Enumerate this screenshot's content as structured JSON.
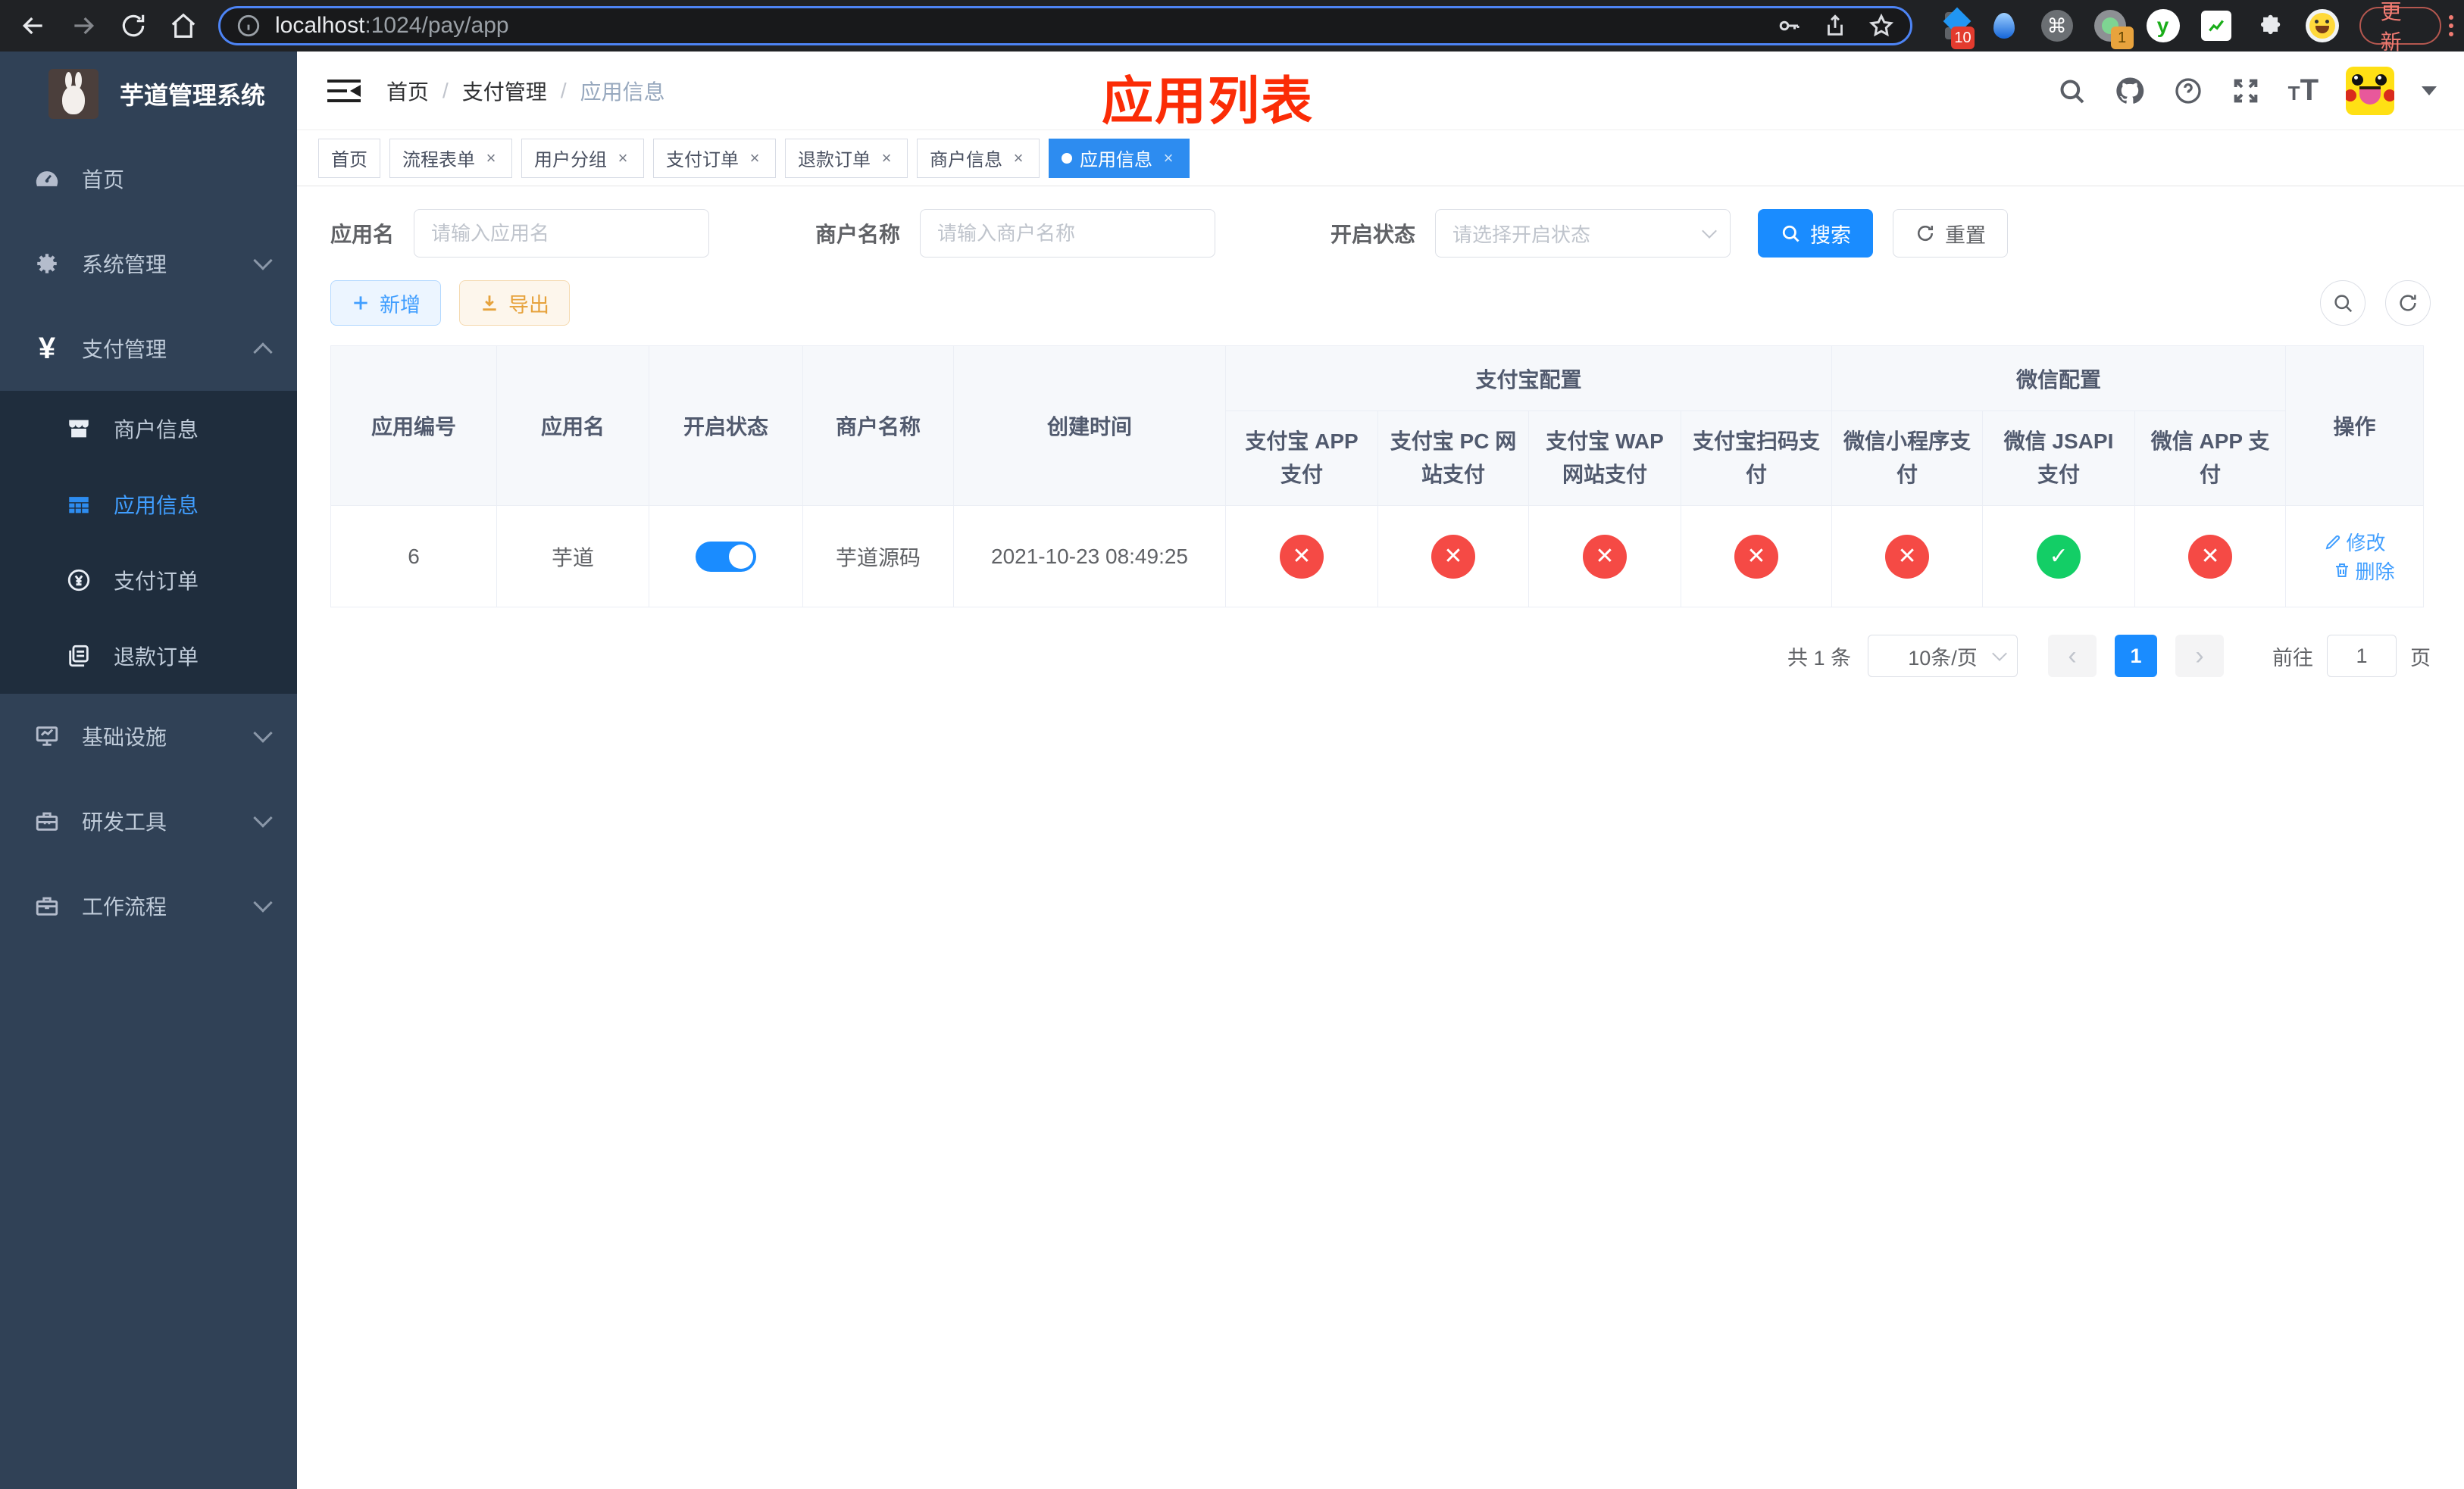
{
  "browser": {
    "url_host": "localhost",
    "url_path": ":1024/pay/app",
    "update_label": "更新",
    "badges": {
      "extension1": "10",
      "extension2": "1"
    }
  },
  "sidebar": {
    "title": "芋道管理系统",
    "items": [
      {
        "label": "首页",
        "icon": "dashboard-icon"
      },
      {
        "label": "系统管理",
        "icon": "gear-icon",
        "expanded": false
      },
      {
        "label": "支付管理",
        "icon": "yen-icon",
        "expanded": true
      },
      {
        "label": "商户信息",
        "icon": "shop-icon",
        "active": false
      },
      {
        "label": "应用信息",
        "icon": "grid-icon",
        "active": true
      },
      {
        "label": "支付订单",
        "icon": "pay-order-icon",
        "active": false
      },
      {
        "label": "退款订单",
        "icon": "refund-icon",
        "active": false
      },
      {
        "label": "基础设施",
        "icon": "monitor-icon",
        "expanded": false
      },
      {
        "label": "研发工具",
        "icon": "toolbox-icon",
        "expanded": false
      },
      {
        "label": "工作流程",
        "icon": "briefcase-icon",
        "expanded": false
      }
    ]
  },
  "navbar": {
    "breadcrumb": [
      "首页",
      "支付管理",
      "应用信息"
    ],
    "annotation": "应用列表",
    "annotation_color": "#fb2c06"
  },
  "tabs": [
    {
      "label": "首页",
      "closable": false,
      "active": false
    },
    {
      "label": "流程表单",
      "closable": true,
      "active": false
    },
    {
      "label": "用户分组",
      "closable": true,
      "active": false
    },
    {
      "label": "支付订单",
      "closable": true,
      "active": false
    },
    {
      "label": "退款订单",
      "closable": true,
      "active": false
    },
    {
      "label": "商户信息",
      "closable": true,
      "active": false
    },
    {
      "label": "应用信息",
      "closable": true,
      "active": true
    }
  ],
  "filters": {
    "app_name_label": "应用名",
    "app_name_placeholder": "请输入应用名",
    "merchant_label": "商户名称",
    "merchant_placeholder": "请输入商户名称",
    "status_label": "开启状态",
    "status_placeholder": "请选择开启状态",
    "search_label": "搜索",
    "reset_label": "重置"
  },
  "toolbar": {
    "add_label": "新增",
    "export_label": "导出"
  },
  "table": {
    "columns": [
      "应用编号",
      "应用名",
      "开启状态",
      "商户名称",
      "创建时间"
    ],
    "group_alipay": "支付宝配置",
    "group_wechat": "微信配置",
    "sub_columns": [
      "支付宝 APP 支付",
      "支付宝 PC 网站支付",
      "支付宝 WAP 网站支付",
      "支付宝扫码支付",
      "微信小程序支付",
      "微信 JSAPI 支付",
      "微信 APP 支付"
    ],
    "actions_label": "操作",
    "edit_label": "修改",
    "delete_label": "删除",
    "row": {
      "id": "6",
      "name": "芋道",
      "enabled": true,
      "merchant": "芋道源码",
      "created_at": "2021-10-23 08:49:25",
      "channels": [
        {
          "name": "alipay_app",
          "enabled": false
        },
        {
          "name": "alipay_pc",
          "enabled": false
        },
        {
          "name": "alipay_wap",
          "enabled": false
        },
        {
          "name": "alipay_qr",
          "enabled": false
        },
        {
          "name": "wx_lite",
          "enabled": false
        },
        {
          "name": "wx_jsapi",
          "enabled": true
        },
        {
          "name": "wx_app",
          "enabled": false
        }
      ]
    }
  },
  "pagination": {
    "total_label": "共 1 条",
    "page_size": "10条/页",
    "current_page": "1",
    "goto_label": "前往",
    "goto_value": "1",
    "page_unit": "页"
  },
  "colors": {
    "primary": "#409eff",
    "active_fill": "#1a8cff",
    "success": "#13ce66",
    "danger": "#f54a45",
    "sidebar_bg": "#304156",
    "submenu_bg": "#1f2d3d"
  }
}
